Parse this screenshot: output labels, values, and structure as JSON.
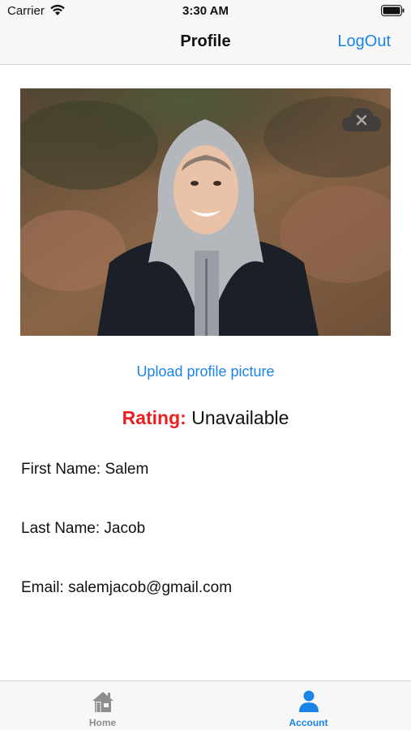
{
  "status_bar": {
    "carrier": "Carrier",
    "time": "3:30 AM",
    "icons": [
      "wifi-icon",
      "battery-icon"
    ]
  },
  "nav": {
    "title": "Profile",
    "action_label": "LogOut"
  },
  "profile": {
    "photo_alt": "Profile photo",
    "remove_photo_icon": "cloud-remove-icon",
    "upload_label": "Upload profile picture",
    "rating_label": "Rating:",
    "rating_value": "Unavailable",
    "first_name": "First Name: Salem",
    "last_name": "Last Name: Jacob",
    "email": "Email: salemjacob@gmail.com"
  },
  "tabs": [
    {
      "label": "Home",
      "icon": "home-icon",
      "active": false
    },
    {
      "label": "Account",
      "icon": "person-icon",
      "active": true
    }
  ],
  "colors": {
    "accent": "#1a84e8",
    "rating_label": "#ec1e1e",
    "inactive_tab": "#8e8e8e",
    "bar_background": "#f7f7f7"
  }
}
